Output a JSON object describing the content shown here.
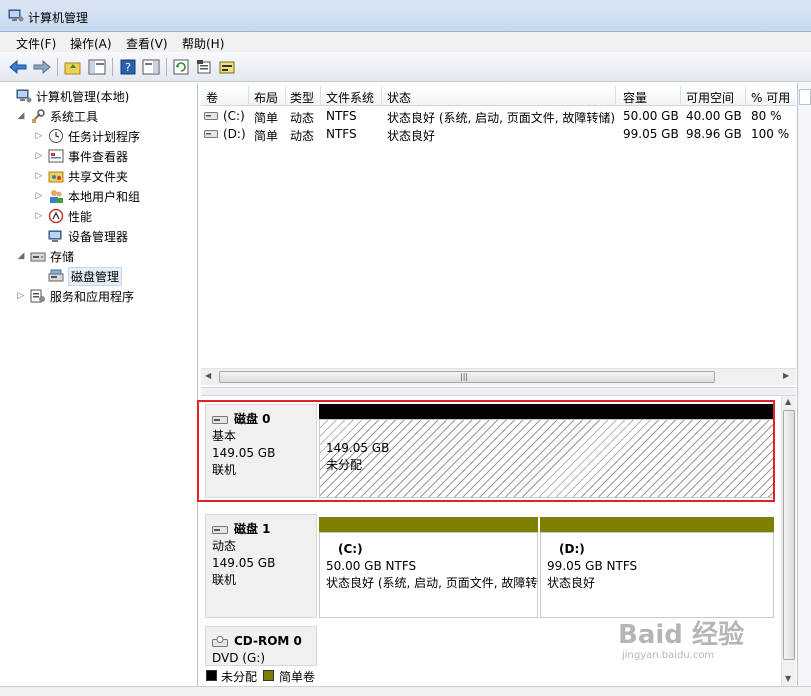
{
  "window": {
    "title": "计算机管理"
  },
  "menu": [
    "文件(F)",
    "操作(A)",
    "查看(V)",
    "帮助(H)"
  ],
  "toolbar": {
    "buttons": [
      "back-icon",
      "forward-icon",
      "up-folder-icon",
      "show-hide-tree-icon",
      "help-icon",
      "show-hide-action-icon",
      "refresh-icon",
      "properties-icon",
      "disk-icon"
    ]
  },
  "tree": {
    "root": "计算机管理(本地)",
    "system_tools": "系统工具",
    "task_scheduler": "任务计划程序",
    "event_viewer": "事件查看器",
    "shared_folders": "共享文件夹",
    "local_users": "本地用户和组",
    "performance": "性能",
    "device_manager": "设备管理器",
    "storage": "存储",
    "disk_management": "磁盘管理",
    "services_apps": "服务和应用程序"
  },
  "volumes": {
    "columns": [
      "卷",
      "布局",
      "类型",
      "文件系统",
      "状态",
      "容量",
      "可用空间",
      "% 可用"
    ],
    "rows": [
      {
        "volume": "(C:)",
        "layout": "简单",
        "type": "动态",
        "fs": "NTFS",
        "status": "状态良好 (系统, 启动, 页面文件, 故障转储)",
        "capacity": "50.00 GB",
        "free": "40.00 GB",
        "pct": "80 %"
      },
      {
        "volume": "(D:)",
        "layout": "简单",
        "type": "动态",
        "fs": "NTFS",
        "status": "状态良好",
        "capacity": "99.05 GB",
        "free": "98.96 GB",
        "pct": "100 %"
      }
    ]
  },
  "disks": {
    "disk0": {
      "name": "磁盘 0",
      "type": "基本",
      "size": "149.05 GB",
      "state": "联机",
      "partition": {
        "size": "149.05 GB",
        "label": "未分配"
      }
    },
    "disk1": {
      "name": "磁盘 1",
      "type": "动态",
      "size": "149.05 GB",
      "state": "联机",
      "partition_c": {
        "letter": "(C:)",
        "size_fs": "50.00 GB NTFS",
        "status": "状态良好 (系统, 启动, 页面文件, 故障转储)"
      },
      "partition_d": {
        "letter": "(D:)",
        "size_fs": "99.05 GB NTFS",
        "status": "状态良好"
      }
    },
    "cdrom0": {
      "name": "CD-ROM 0",
      "detail": "DVD (G:)"
    }
  },
  "legend": {
    "unallocated": "未分配",
    "simple": "简单卷"
  },
  "colors": {
    "unallocated": "#000000",
    "simple_volume": "#808000",
    "highlight": "#e0222a"
  },
  "watermark": {
    "main": "Baid 经验",
    "sub": "jingyan.baidu.com"
  }
}
